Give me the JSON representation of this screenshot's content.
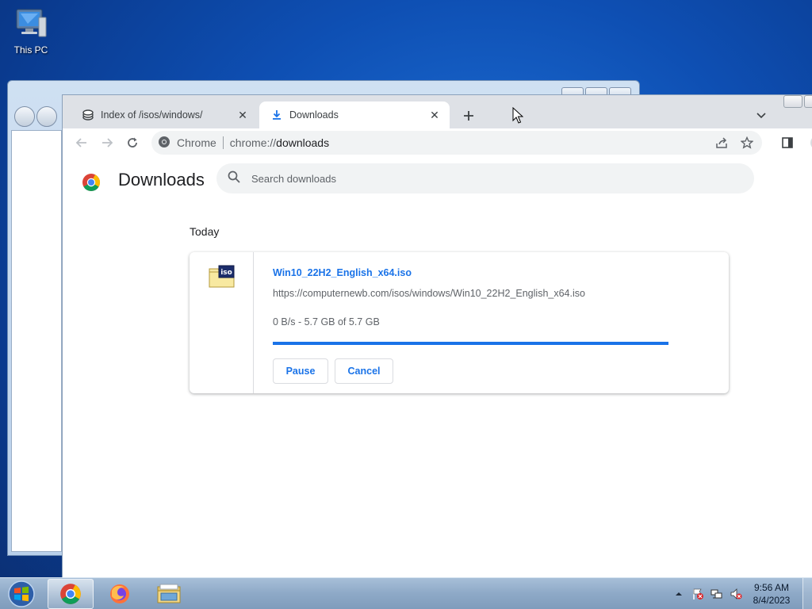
{
  "desktop": {
    "icons": [
      {
        "label": "This PC",
        "icon": "computer-icon"
      }
    ]
  },
  "browser": {
    "tabs": [
      {
        "title": "Index of /isos/windows/",
        "icon": "page-icon",
        "active": false
      },
      {
        "title": "Downloads",
        "icon": "download-icon",
        "active": true
      }
    ],
    "address_bar": {
      "site_label": "Chrome",
      "scheme": "chrome://",
      "path": "downloads"
    }
  },
  "downloads_page": {
    "title": "Downloads",
    "search_placeholder": "Search downloads",
    "date_group": "Today",
    "items": [
      {
        "file_name": "Win10_22H2_English_x64.iso",
        "url": "https://computernewb.com/isos/windows/Win10_22H2_English_x64.iso",
        "status": "0 B/s - 5.7 GB of 5.7 GB",
        "progress_percent": 100,
        "icon_text": "iso",
        "pause_label": "Pause",
        "cancel_label": "Cancel"
      }
    ]
  },
  "taskbar": {
    "pinned": [
      {
        "name": "chrome",
        "active": true
      },
      {
        "name": "firefox",
        "active": false
      },
      {
        "name": "file-explorer",
        "active": false
      }
    ],
    "clock": {
      "time": "9:56 AM",
      "date": "8/4/2023"
    }
  },
  "colors": {
    "accent": "#1a73e8",
    "tab_strip": "#dee1e6",
    "omnibox": "#f1f3f4"
  }
}
